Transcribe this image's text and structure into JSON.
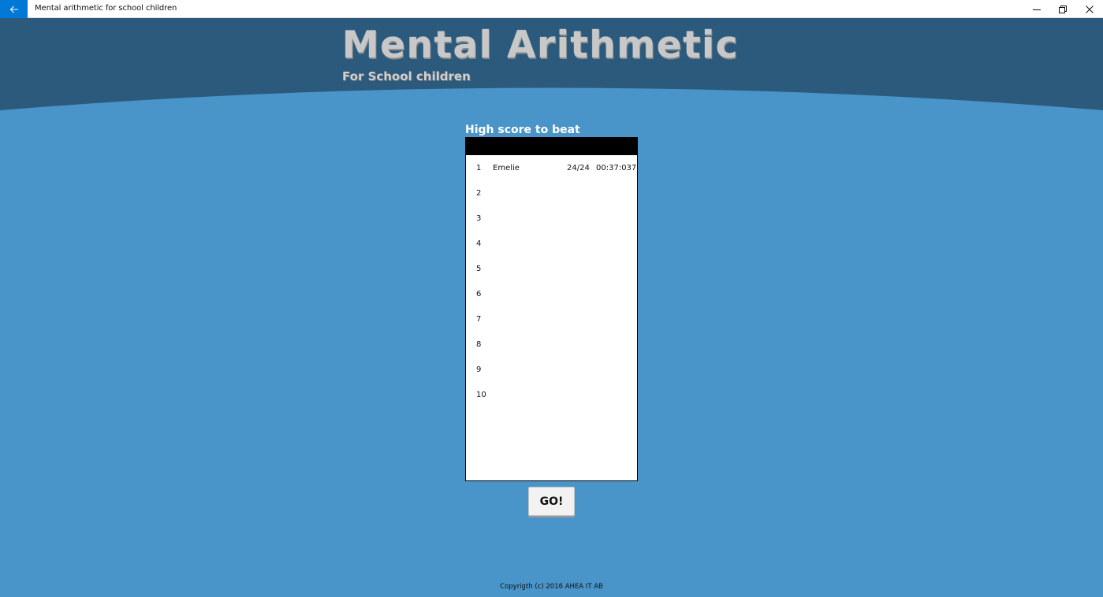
{
  "window": {
    "title": "Mental arithmetic for school children"
  },
  "icons": {
    "back": "arrow-left-icon",
    "minimize": "minimize-icon",
    "maximize": "restore-icon",
    "close": "close-icon"
  },
  "colors": {
    "accent": "#0078d7",
    "header_band": "#2c5a7c",
    "background": "#4994c9"
  },
  "header": {
    "title": "Mental Arithmetic",
    "subtitle": "For School children"
  },
  "highscore": {
    "heading": "High score to beat",
    "rows": [
      {
        "rank": "1",
        "name": "Emelie",
        "score": "24/24",
        "time": "00:37:037"
      },
      {
        "rank": "2",
        "name": "",
        "score": "",
        "time": ""
      },
      {
        "rank": "3",
        "name": "",
        "score": "",
        "time": ""
      },
      {
        "rank": "4",
        "name": "",
        "score": "",
        "time": ""
      },
      {
        "rank": "5",
        "name": "",
        "score": "",
        "time": ""
      },
      {
        "rank": "6",
        "name": "",
        "score": "",
        "time": ""
      },
      {
        "rank": "7",
        "name": "",
        "score": "",
        "time": ""
      },
      {
        "rank": "8",
        "name": "",
        "score": "",
        "time": ""
      },
      {
        "rank": "9",
        "name": "",
        "score": "",
        "time": ""
      },
      {
        "rank": "10",
        "name": "",
        "score": "",
        "time": ""
      }
    ]
  },
  "go_button": {
    "label": "GO!"
  },
  "footer": {
    "copyright": "Copyrigth (c) 2016 AHEA IT AB"
  }
}
